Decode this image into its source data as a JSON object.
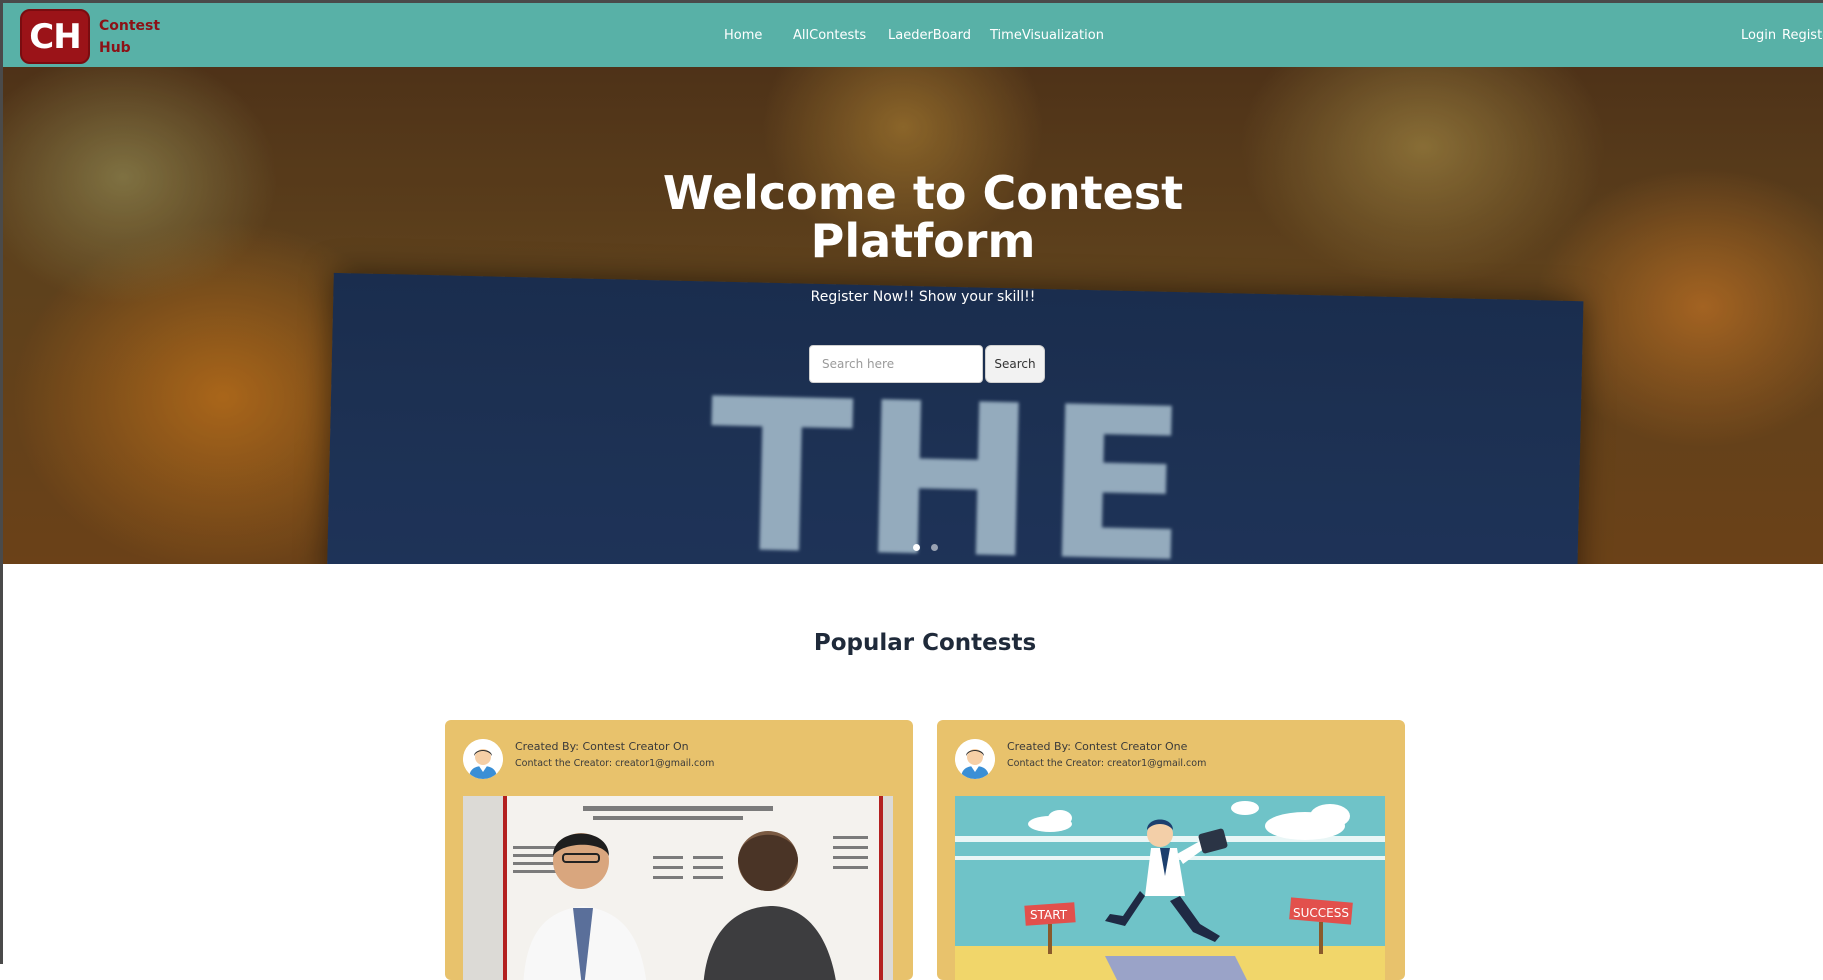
{
  "brand": {
    "logo_initials": "CH",
    "name": "Contest Hub"
  },
  "nav": {
    "links": [
      "Home",
      "AllContests",
      "LaederBoard",
      "TimeVisualization"
    ],
    "login": "Login",
    "register": "Registe"
  },
  "hero": {
    "title_line1": "Welcome to Contest",
    "title_line2": "Platform",
    "subtitle": "Register Now!! Show your skill!!",
    "search_placeholder": "Search here",
    "search_button": "Search",
    "background_text": "THE",
    "slide_count": 2,
    "active_slide": 1
  },
  "popular": {
    "title": "Popular Contests",
    "cards": [
      {
        "creator": "Created By: Contest Creator On",
        "contact": "Contact the Creator: creator1@gmail.com"
      },
      {
        "creator": "Created By: Contest Creator One",
        "contact": "Contact the Creator: creator1@gmail.com"
      }
    ]
  },
  "colors": {
    "navbar": "#58b1a7",
    "logo": "#9b1318",
    "card": "#e8c26c",
    "heading": "#1f2a3a"
  }
}
